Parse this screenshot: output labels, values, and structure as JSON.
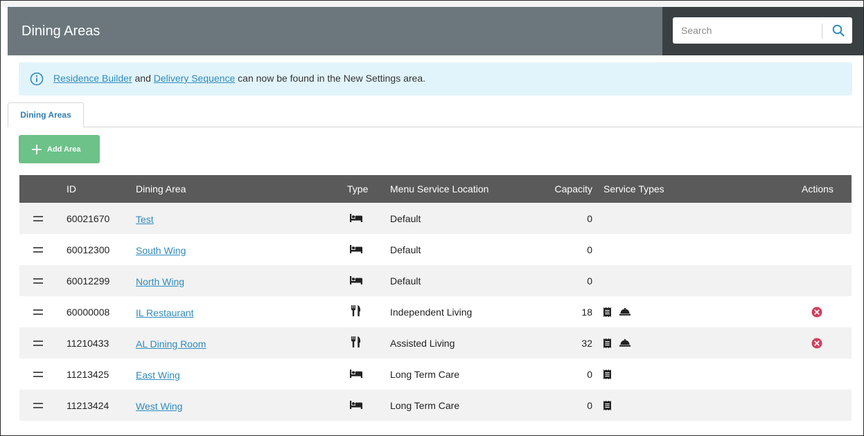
{
  "header": {
    "title": "Dining Areas"
  },
  "search": {
    "placeholder": "Search"
  },
  "banner": {
    "link1": "Residence Builder",
    "connector": "and",
    "link2": "Delivery Sequence",
    "text": "can now be found in the New Settings area."
  },
  "tabs": [
    {
      "label": "Dining Areas",
      "active": true
    }
  ],
  "toolbar": {
    "add_label": "Add Area"
  },
  "table": {
    "columns": [
      "ID",
      "Dining Area",
      "Type",
      "Menu Service Location",
      "Capacity",
      "Service Types",
      "Actions"
    ],
    "rows": [
      {
        "id": "60021670",
        "name": "Test",
        "type_icon": "bed-icon",
        "location": "Default",
        "capacity": "0",
        "service_icons": [],
        "deletable": false
      },
      {
        "id": "60012300",
        "name": "South Wing",
        "type_icon": "bed-icon",
        "location": "Default",
        "capacity": "0",
        "service_icons": [],
        "deletable": false
      },
      {
        "id": "60012299",
        "name": "North Wing",
        "type_icon": "bed-icon",
        "location": "Default",
        "capacity": "0",
        "service_icons": [],
        "deletable": false
      },
      {
        "id": "60000008",
        "name": "IL Restaurant",
        "type_icon": "utensils-icon",
        "location": "Independent Living",
        "capacity": "18",
        "service_icons": [
          "receipt-icon",
          "cloche-icon"
        ],
        "deletable": true
      },
      {
        "id": "11210433",
        "name": "AL Dining Room",
        "type_icon": "utensils-icon",
        "location": "Assisted Living",
        "capacity": "32",
        "service_icons": [
          "receipt-icon",
          "cloche-icon"
        ],
        "deletable": true
      },
      {
        "id": "11213425",
        "name": "East Wing",
        "type_icon": "bed-icon",
        "location": "Long Term Care",
        "capacity": "0",
        "service_icons": [
          "receipt-icon"
        ],
        "deletable": false
      },
      {
        "id": "11213424",
        "name": "West Wing",
        "type_icon": "bed-icon",
        "location": "Long Term Care",
        "capacity": "0",
        "service_icons": [
          "receipt-icon"
        ],
        "deletable": false
      }
    ]
  },
  "colors": {
    "header_bg": "#6b777c",
    "search_bg": "#3a3f42",
    "banner_bg": "#e2f4fb",
    "link": "#2f8bbd",
    "add_button": "#6cc288",
    "table_header": "#5a5a5a",
    "delete": "#d23f5e"
  }
}
